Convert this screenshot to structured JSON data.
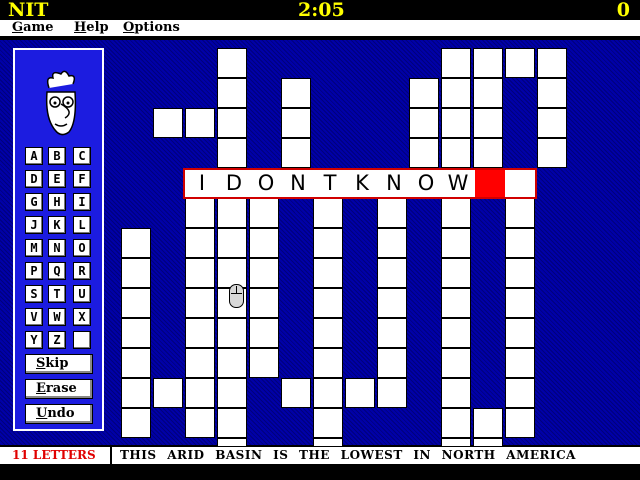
{
  "titlebar": {
    "app_name": "NIT",
    "timer": "2:05",
    "score": "0"
  },
  "menu": {
    "items": [
      "Game",
      "Help",
      "Options"
    ]
  },
  "keyboard": {
    "rows": [
      [
        "A",
        "B",
        "C"
      ],
      [
        "D",
        "E",
        "F"
      ],
      [
        "G",
        "H",
        "I"
      ],
      [
        "J",
        "K",
        "L"
      ],
      [
        "M",
        "N",
        "O"
      ],
      [
        "P",
        "Q",
        "R"
      ],
      [
        "S",
        "T",
        "U"
      ],
      [
        "V",
        "W",
        "X"
      ],
      [
        "Y",
        "Z",
        ""
      ]
    ]
  },
  "buttons": {
    "skip": "Skip",
    "erase": "Erase",
    "undo": "Undo"
  },
  "answer": {
    "letters": [
      "I",
      "D",
      "O",
      "N",
      "T",
      "K",
      "N",
      "O",
      "W",
      "",
      ""
    ],
    "cursor_index": 9
  },
  "status": {
    "letter_count": "11 LETTERS",
    "clue": "THIS ARID BASIN IS THE LOWEST IN NORTH AMERICA"
  },
  "colors": {
    "title_text": "#ffff00",
    "board_bg": "#0000a8",
    "panel_bg": "#1c1ce0",
    "cursor": "#ff0000",
    "status_letters": "#e00000"
  },
  "icons": {
    "mascot": "cartoon-face-icon",
    "pointer": "mouse-icon"
  }
}
